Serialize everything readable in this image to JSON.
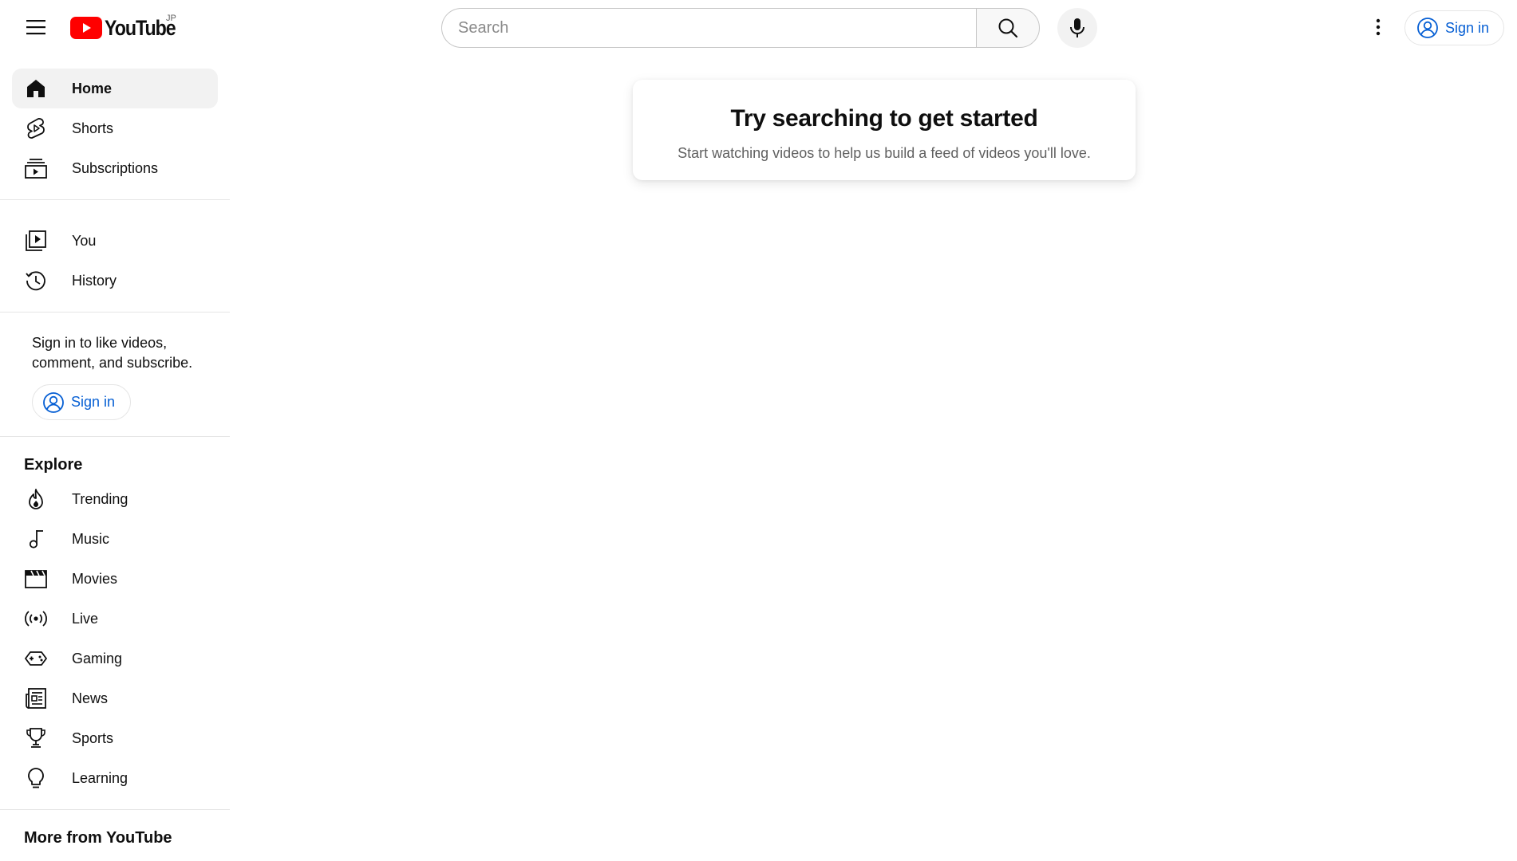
{
  "header": {
    "menu_icon": "hamburger-menu-icon",
    "logo_text": "YouTube",
    "region_code": "JP",
    "search": {
      "placeholder": "Search",
      "value": ""
    },
    "search_icon": "search-icon",
    "mic_icon": "microphone-icon",
    "more_icon": "more-vertical-icon",
    "sign_in_label": "Sign in"
  },
  "sidebar": {
    "primary": [
      {
        "label": "Home",
        "icon": "home-icon",
        "active": true
      },
      {
        "label": "Shorts",
        "icon": "shorts-icon"
      },
      {
        "label": "Subscriptions",
        "icon": "subscriptions-icon"
      }
    ],
    "you": [
      {
        "label": "You",
        "icon": "you-icon"
      },
      {
        "label": "History",
        "icon": "history-icon"
      }
    ],
    "signin_prompt": "Sign in to like videos, comment, and subscribe.",
    "signin_label": "Sign in",
    "explore_title": "Explore",
    "explore": [
      {
        "label": "Trending",
        "icon": "trending-icon"
      },
      {
        "label": "Music",
        "icon": "music-icon"
      },
      {
        "label": "Movies",
        "icon": "movies-icon"
      },
      {
        "label": "Live",
        "icon": "live-icon"
      },
      {
        "label": "Gaming",
        "icon": "gaming-icon"
      },
      {
        "label": "News",
        "icon": "news-icon"
      },
      {
        "label": "Sports",
        "icon": "sports-icon"
      },
      {
        "label": "Learning",
        "icon": "learning-icon"
      }
    ],
    "more_title": "More from YouTube"
  },
  "main": {
    "title": "Try searching to get started",
    "subtitle": "Start watching videos to help us build a feed of videos you'll love."
  },
  "colors": {
    "brand_red": "#ff0000",
    "link_blue": "#065fd4",
    "text": "#0f0f0f",
    "muted": "#606060"
  }
}
